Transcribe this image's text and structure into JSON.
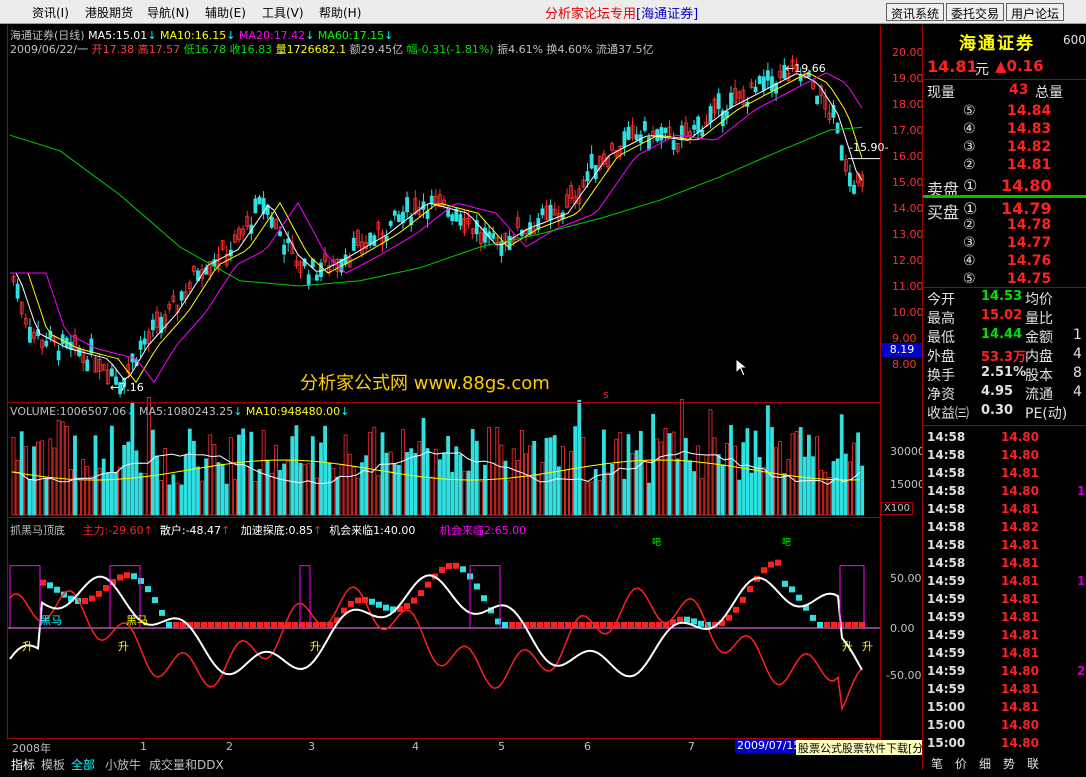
{
  "menu": {
    "items": [
      "资讯(I)",
      "港股期货",
      "导航(N)",
      "辅助(E)",
      "工具(V)",
      "帮助(H)"
    ],
    "brand": "分析家论坛专用",
    "broker": "[海通证券]",
    "right_buttons": [
      "资讯系统",
      "委托交易",
      "用户论坛"
    ]
  },
  "main": {
    "title": "海通证券(日线)",
    "ma": [
      {
        "label": "MA5:15.01",
        "color": "#ffffff"
      },
      {
        "label": "MA10:16.15",
        "color": "#ffff00"
      },
      {
        "label": "MA20:17.42",
        "color": "#ff00ff"
      },
      {
        "label": "MA60:17.15",
        "color": "#00ff00"
      }
    ],
    "quote": {
      "date": "2009/06/22/一",
      "open": "开17.38",
      "high": "高17.57",
      "low": "低16.78",
      "close": "收16.83",
      "vol": "量1726682.1",
      "amt": "额29.45亿",
      "chg": "幅-0.31(-1.81%)",
      "amp": "振4.61%",
      "turn": "换4.60%",
      "flow": "流通37.5亿"
    },
    "y_ticks": [
      "20.00",
      "19.00",
      "18.00",
      "17.00",
      "16.00",
      "15.00",
      "14.00",
      "13.00",
      "12.00",
      "11.00",
      "10.00",
      "9.00",
      "8.00"
    ],
    "price_marker": "8.19",
    "high_mark": "19.66",
    "low_mark": "7.16",
    "mid_mark": "15.90",
    "watermark": "分析家公式网 www.88gs.com",
    "s_mark": "s"
  },
  "volume": {
    "title": "VOLUME:1006507.06",
    "ma5": "MA5:1080243.25",
    "ma10": "MA10:948480.00",
    "y_ticks": [
      "30000",
      "15000"
    ],
    "unit": "X100"
  },
  "indicator": {
    "title": "抓黑马顶底",
    "main": "主力:-29.60",
    "retail": "散户:-48.47",
    "accel": "加速探底:0.85",
    "chance1": "机会来临1:40.00",
    "chance2": "机会来临2:65.00",
    "y_ticks": [
      "50.00",
      "0.00",
      "-50.00"
    ],
    "labels": {
      "hm": "黑马",
      "hm2": "黑马",
      "up": "升",
      "drop": "吧"
    }
  },
  "timeline": {
    "labels": [
      "2008年",
      "1",
      "2",
      "3",
      "4",
      "5",
      "6",
      "7"
    ],
    "date_box": "2009/07/15"
  },
  "bottom": {
    "tabs": [
      "指标",
      "模板",
      "全部",
      "小放牛",
      "成交量和DDX"
    ],
    "banner": "股票公式股票软件下载[分析家公式网www.88gs.com]"
  },
  "panel": {
    "name": "海通证券",
    "code": "600",
    "price": "14.81",
    "unit": "元",
    "change": "▲0.16",
    "now_vol_label": "现量",
    "now_vol": "43",
    "total_label": "总量",
    "asks": [
      {
        "n": "⑤",
        "p": "14.84"
      },
      {
        "n": "④",
        "p": "14.83"
      },
      {
        "n": "③",
        "p": "14.82"
      },
      {
        "n": "②",
        "p": "14.81"
      }
    ],
    "ask1_label": "卖盘",
    "ask1_n": "①",
    "ask1_p": "14.80",
    "bid1_label": "买盘",
    "bid1_n": "①",
    "bid1_p": "14.79",
    "bids": [
      {
        "n": "②",
        "p": "14.78"
      },
      {
        "n": "③",
        "p": "14.77"
      },
      {
        "n": "④",
        "p": "14.76"
      },
      {
        "n": "⑤",
        "p": "14.75"
      }
    ],
    "stats": [
      {
        "l": "今开",
        "v": "14.53",
        "c": "#00e000",
        "l2": "均价",
        "v2": ""
      },
      {
        "l": "最高",
        "v": "15.02",
        "c": "#ff2020",
        "l2": "量比",
        "v2": ""
      },
      {
        "l": "最低",
        "v": "14.44",
        "c": "#00e000",
        "l2": "金额",
        "v2": "1"
      },
      {
        "l": "外盘",
        "v": "53.3万",
        "c": "#ff2020",
        "l2": "内盘",
        "v2": "4"
      },
      {
        "l": "换手",
        "v": "2.51%",
        "c": "#e0e0e0",
        "l2": "股本",
        "v2": "8"
      },
      {
        "l": "净资",
        "v": "4.95",
        "c": "#e0e0e0",
        "l2": "流通",
        "v2": "4"
      },
      {
        "l": "收益㈢",
        "v": "0.30",
        "c": "#e0e0e0",
        "l2": "PE(动)",
        "v2": ""
      }
    ],
    "ticks": [
      {
        "t": "14:58",
        "p": "14.80",
        "c": "#ff2020",
        "v": "",
        "vc": "#ff2020"
      },
      {
        "t": "14:58",
        "p": "14.80",
        "c": "#ff2020",
        "v": "",
        "vc": "#ff2020"
      },
      {
        "t": "14:58",
        "p": "14.81",
        "c": "#ff2020",
        "v": "",
        "vc": "#ff2020"
      },
      {
        "t": "14:58",
        "p": "14.80",
        "c": "#ff2020",
        "v": "1",
        "vc": "#c000c0"
      },
      {
        "t": "14:58",
        "p": "14.81",
        "c": "#ff2020",
        "v": "",
        "vc": "#ff2020"
      },
      {
        "t": "14:58",
        "p": "14.82",
        "c": "#ff2020",
        "v": "",
        "vc": "#ff2020"
      },
      {
        "t": "14:58",
        "p": "14.81",
        "c": "#ff2020",
        "v": "",
        "vc": "#ff2020"
      },
      {
        "t": "14:58",
        "p": "14.81",
        "c": "#ff2020",
        "v": "",
        "vc": "#ff2020"
      },
      {
        "t": "14:59",
        "p": "14.81",
        "c": "#ff2020",
        "v": "1",
        "vc": "#c000c0"
      },
      {
        "t": "14:59",
        "p": "14.81",
        "c": "#ff2020",
        "v": "",
        "vc": "#ff2020"
      },
      {
        "t": "14:59",
        "p": "14.81",
        "c": "#ff2020",
        "v": "",
        "vc": "#ff2020"
      },
      {
        "t": "14:59",
        "p": "14.81",
        "c": "#ff2020",
        "v": "",
        "vc": "#ff2020"
      },
      {
        "t": "14:59",
        "p": "14.81",
        "c": "#ff2020",
        "v": "",
        "vc": "#ff2020"
      },
      {
        "t": "14:59",
        "p": "14.80",
        "c": "#ff2020",
        "v": "2",
        "vc": "#c000c0"
      },
      {
        "t": "14:59",
        "p": "14.81",
        "c": "#ff2020",
        "v": "",
        "vc": "#ff2020"
      },
      {
        "t": "15:00",
        "p": "14.81",
        "c": "#ff2020",
        "v": "",
        "vc": "#ff2020"
      },
      {
        "t": "15:00",
        "p": "14.80",
        "c": "#ff2020",
        "v": "",
        "vc": "#ff2020"
      },
      {
        "t": "15:00",
        "p": "14.80",
        "c": "#ff2020",
        "v": "",
        "vc": "#ff2020"
      }
    ],
    "bottom_tabs": [
      "笔",
      "价",
      "细",
      "势",
      "联"
    ]
  }
}
